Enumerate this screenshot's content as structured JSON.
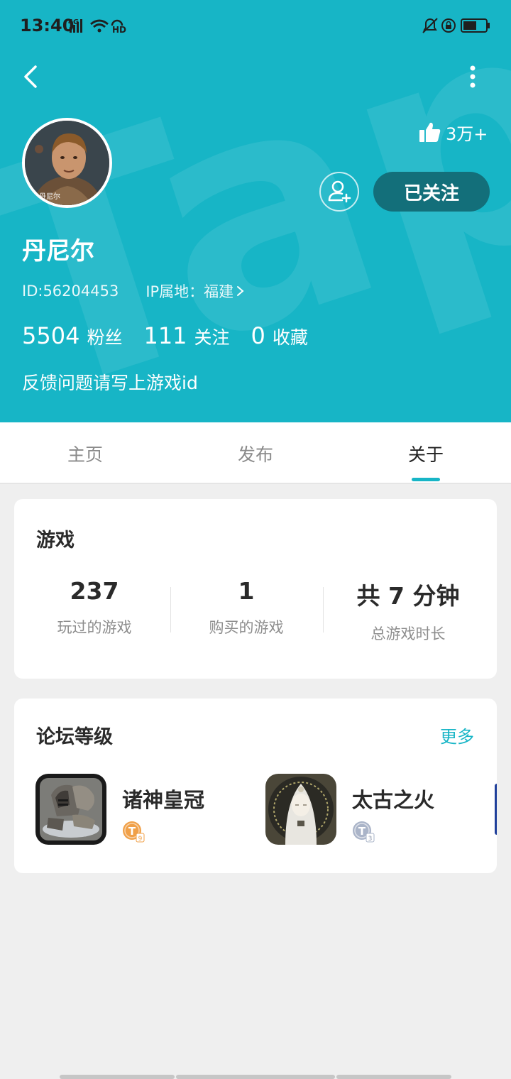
{
  "status_bar": {
    "time": "13:40",
    "network": "4G",
    "hd": "HD"
  },
  "header": {
    "watermark_text": "TapTap",
    "username": "丹尼尔",
    "avatar_caption": "丹尼尔",
    "likes": "3万+",
    "follow_label": "已关注",
    "id_text": "ID:56204453",
    "ip_text": "IP属地：福建",
    "stats": [
      {
        "value": "5504",
        "label": "粉丝"
      },
      {
        "value": "111",
        "label": "关注"
      },
      {
        "value": "0",
        "label": "收藏"
      }
    ],
    "bio": "反馈问题请写上游戏id"
  },
  "tabs": [
    {
      "label": "主页"
    },
    {
      "label": "发布"
    },
    {
      "label": "关于"
    }
  ],
  "games": {
    "title": "游戏",
    "stats": [
      {
        "value": "237",
        "label": "玩过的游戏"
      },
      {
        "value": "1",
        "label": "购买的游戏"
      },
      {
        "value": "共 7 分钟",
        "label": "总游戏时长"
      }
    ]
  },
  "forum": {
    "title": "论坛等级",
    "more": "更多",
    "items": [
      {
        "name": "诸神皇冠",
        "badge": "T",
        "badge_level": "9"
      },
      {
        "name": "太古之火",
        "badge": "T",
        "badge_level": "3"
      }
    ]
  },
  "colors": {
    "accent": "#17b5c6",
    "follow_button": "#136f7a",
    "badge_orange": "#f0a048",
    "badge_silver": "#aab4c8"
  }
}
